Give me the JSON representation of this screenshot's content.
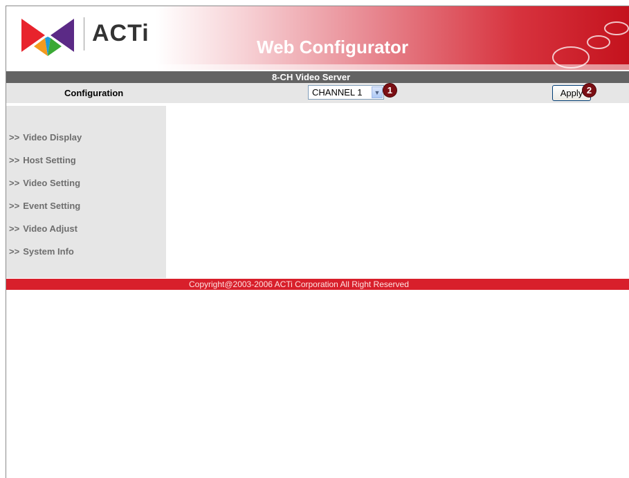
{
  "header": {
    "logo_text": "ACTi",
    "app_title": "Web Configurator"
  },
  "title_bar": {
    "device_name": "8-CH Video Server"
  },
  "config_bar": {
    "label": "Configuration",
    "channel_select": {
      "value": "CHANNEL 1"
    },
    "apply_label": "Apply",
    "badges": [
      "1",
      "2"
    ]
  },
  "sidebar": {
    "marker": ">>",
    "items": [
      {
        "label": "Video Display"
      },
      {
        "label": "Host Setting"
      },
      {
        "label": "Video Setting"
      },
      {
        "label": "Event Setting"
      },
      {
        "label": "Video Adjust"
      },
      {
        "label": "System Info"
      }
    ]
  },
  "footer": {
    "copyright": "Copyright@2003-2006 ACTi Corporation All Right Reserved"
  },
  "colors": {
    "brand_red": "#d81f2b",
    "title_bar_gray": "#636363",
    "panel_gray": "#e6e6e6",
    "badge_maroon": "#7b0f14"
  }
}
